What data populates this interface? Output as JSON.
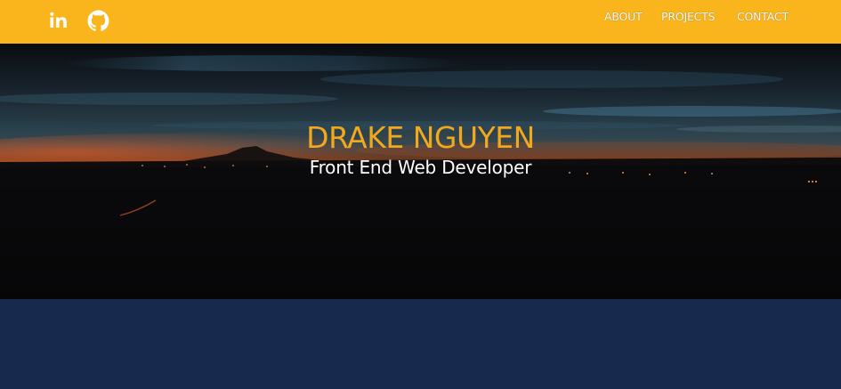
{
  "header": {
    "social": [
      {
        "name": "linkedin",
        "icon": "linkedin-icon"
      },
      {
        "name": "github",
        "icon": "github-icon"
      }
    ],
    "nav": [
      {
        "label": "ABOUT"
      },
      {
        "label": "PROJECTS"
      },
      {
        "label": "CONTACT"
      }
    ]
  },
  "hero": {
    "name": "DRAKE NGUYEN",
    "subtitle": "Front End Web Developer"
  },
  "colors": {
    "header_bg": "#fbb51c",
    "name_accent": "#f2a81d",
    "section_bg": "#172a4e"
  }
}
